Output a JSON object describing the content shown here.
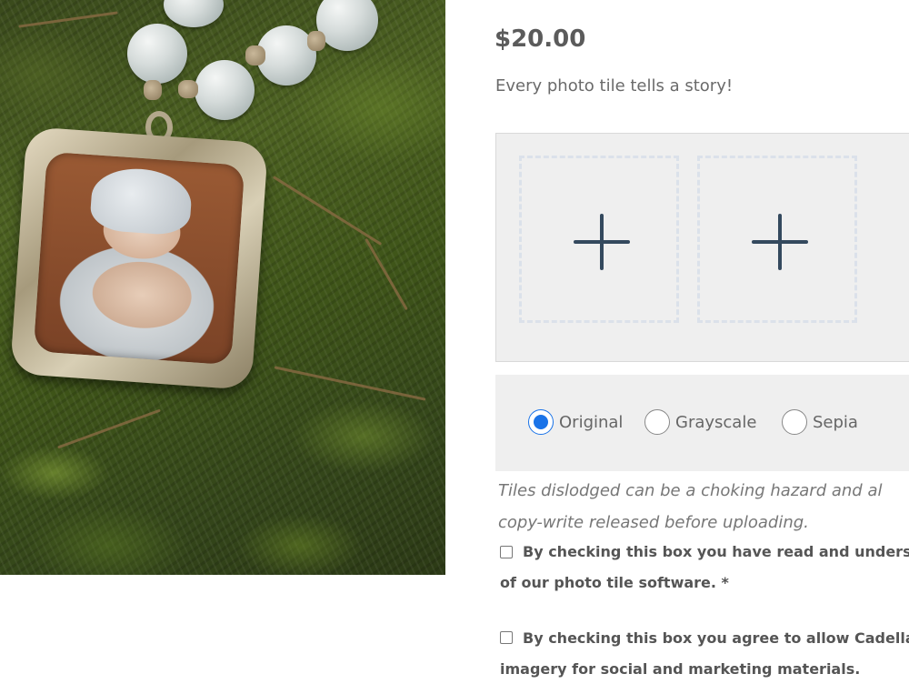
{
  "product": {
    "price": "$20.00",
    "tagline": "Every photo tile tells a story!"
  },
  "tile_upload": {
    "slots": [
      {
        "icon": "plus-icon"
      },
      {
        "icon": "plus-icon"
      }
    ]
  },
  "filters": {
    "options": [
      {
        "label": "Original",
        "checked": true
      },
      {
        "label": "Grayscale",
        "checked": false
      },
      {
        "label": "Sepia",
        "checked": false
      }
    ],
    "accent_color": "#1a73e8"
  },
  "notice": {
    "line1": "Tiles dislodged can be a choking hazard and al",
    "line2": "copy-write released before uploading."
  },
  "consents": [
    {
      "line1": "By checking this box you have read and understo",
      "line2": "of our photo tile software. *",
      "checked": false
    },
    {
      "line1": "By checking this box you agree to allow Cadella’s",
      "line2": "imagery for social and marketing materials.",
      "checked": false
    }
  ]
}
